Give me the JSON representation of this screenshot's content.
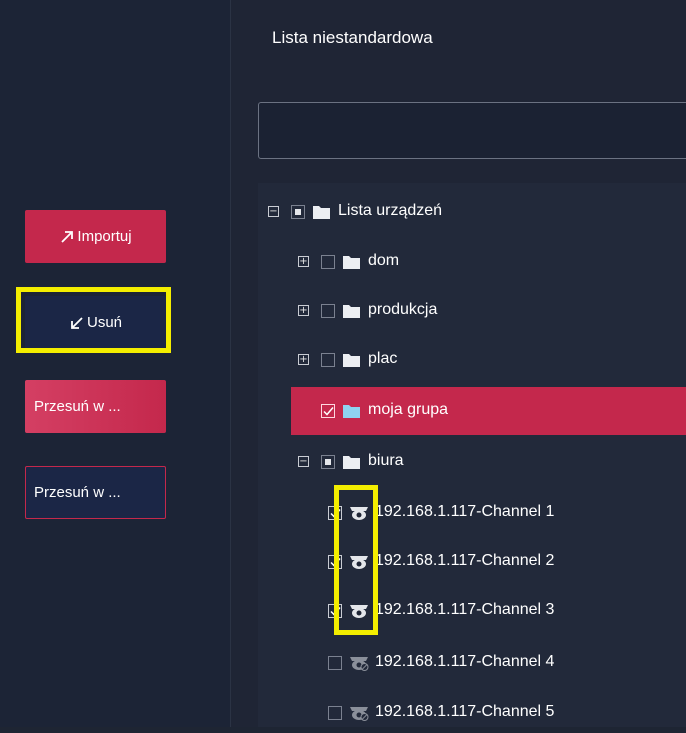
{
  "left": {
    "import_label": "Importuj",
    "remove_label": "Usuń",
    "move1_label": "Przesuń w ...",
    "move2_label": "Przesuń w ..."
  },
  "right": {
    "title": "Lista niestandardowa",
    "search_value": "",
    "tree": {
      "root": {
        "label": "Lista urządzeń",
        "state": "partial",
        "expanded": true
      },
      "groups": [
        {
          "label": "dom",
          "state": "unchecked",
          "expanded": false
        },
        {
          "label": "produkcja",
          "state": "unchecked",
          "expanded": false
        },
        {
          "label": "plac",
          "state": "unchecked",
          "expanded": false
        },
        {
          "label": "moja grupa",
          "state": "checked",
          "selected": true
        },
        {
          "label": "biura",
          "state": "partial",
          "expanded": true
        }
      ],
      "channels": [
        {
          "label": "192.168.1.117-Channel 1",
          "checked": true
        },
        {
          "label": "192.168.1.117-Channel 2",
          "checked": true
        },
        {
          "label": "192.168.1.117-Channel 3",
          "checked": true
        },
        {
          "label": "192.168.1.117-Channel 4",
          "checked": false
        },
        {
          "label": "192.168.1.117-Channel 5",
          "checked": false
        }
      ]
    }
  },
  "colors": {
    "accent": "#c4284c",
    "highlight": "#f4ee00",
    "panel_bg": "#1f2535",
    "button_dark": "#1b2646"
  }
}
